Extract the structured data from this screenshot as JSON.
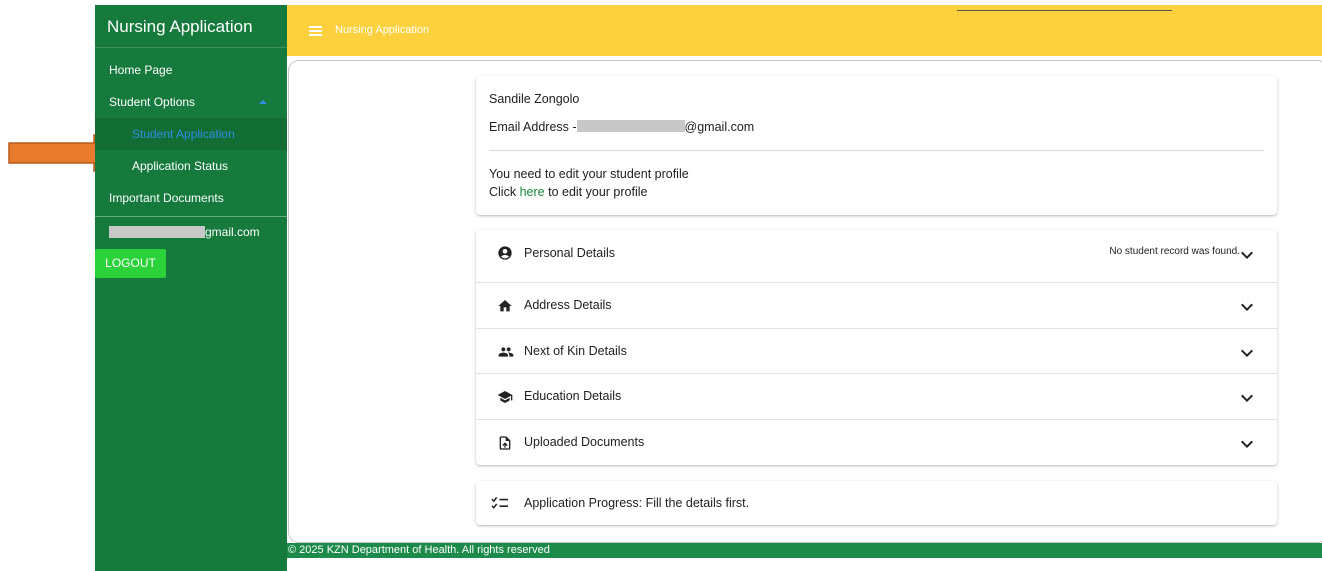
{
  "app": {
    "title": "Nursing Application"
  },
  "header": {
    "title": "Nursing Application",
    "menu_icon": "menu-icon"
  },
  "sidebar": {
    "items": [
      {
        "label": "Home Page"
      },
      {
        "label": "Student Options"
      },
      {
        "label": "Student Application"
      },
      {
        "label": "Application Status"
      },
      {
        "label": "Important Documents"
      }
    ],
    "user_email_visible": "gmail.com",
    "logout_label": "LOGOUT"
  },
  "profile": {
    "name": "Sandile Zongolo",
    "email_prefix": "Email Address -",
    "email_suffix": "@gmail.com",
    "note_line1": "You need to edit your student profile",
    "note_click": "Click",
    "note_link": "here",
    "note_rest": "to edit your profile"
  },
  "accordion": {
    "sections": [
      {
        "label": "Personal Details",
        "icon": "account-circle-icon",
        "status": "No student record was found."
      },
      {
        "label": "Address Details",
        "icon": "home-icon"
      },
      {
        "label": "Next of Kin Details",
        "icon": "people-icon"
      },
      {
        "label": "Education Details",
        "icon": "graduation-cap-icon"
      },
      {
        "label": "Uploaded Documents",
        "icon": "upload-file-icon"
      }
    ]
  },
  "progress": {
    "label": "Application Progress: Fill the details first.",
    "icon": "checklist-icon"
  },
  "footer": {
    "text": "© 2025 KZN Department of Health. All rights reserved"
  },
  "colors": {
    "sidebar": "#157a3c",
    "header": "#fdd13d",
    "logout": "#2bd23a",
    "active_link": "#2f8de6",
    "footer": "#1c8a4b",
    "arrow": "#e87a2e"
  }
}
